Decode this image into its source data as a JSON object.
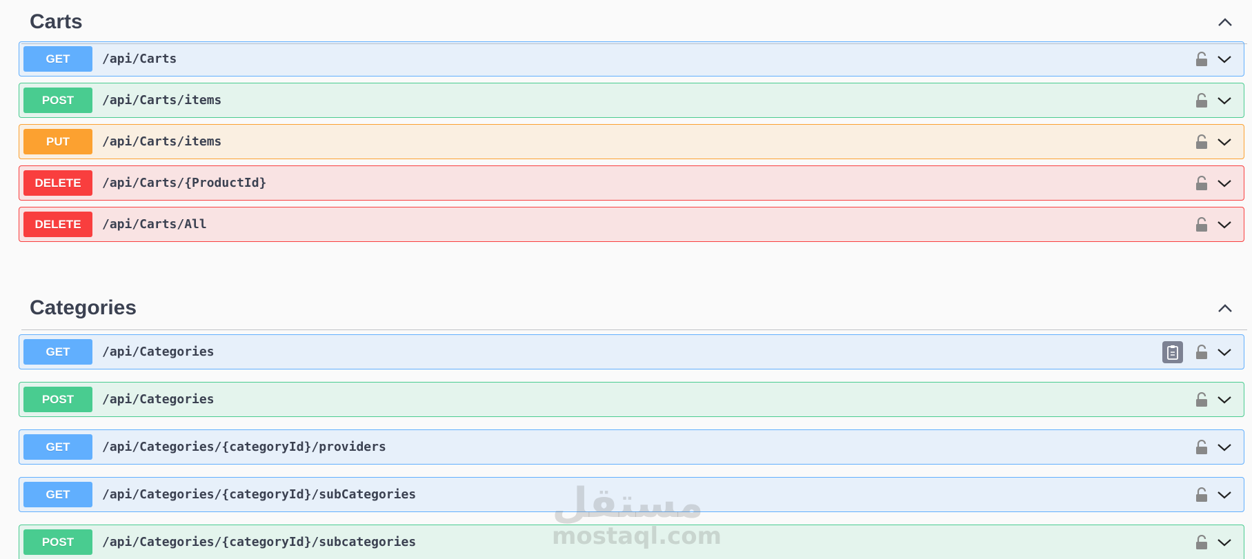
{
  "sections": [
    {
      "title": "Carts",
      "operations": [
        {
          "method": "GET",
          "path": "/api/Carts"
        },
        {
          "method": "POST",
          "path": "/api/Carts/items"
        },
        {
          "method": "PUT",
          "path": "/api/Carts/items"
        },
        {
          "method": "DELETE",
          "path": "/api/Carts/{ProductId}"
        },
        {
          "method": "DELETE",
          "path": "/api/Carts/All"
        }
      ]
    },
    {
      "title": "Categories",
      "operations": [
        {
          "method": "GET",
          "path": "/api/Categories"
        },
        {
          "method": "POST",
          "path": "/api/Categories"
        },
        {
          "method": "GET",
          "path": "/api/Categories/{categoryId}/providers"
        },
        {
          "method": "GET",
          "path": "/api/Categories/{categoryId}/subCategories"
        },
        {
          "method": "POST",
          "path": "/api/Categories/{categoryId}/subcategories"
        }
      ]
    }
  ],
  "icons": {
    "lock": "lock-icon",
    "expand": "chevron-down-icon",
    "collapse": "chevron-up-icon",
    "copy": "clipboard-copy-icon"
  },
  "colors": {
    "get": "#61affe",
    "post": "#49cc90",
    "put": "#fca130",
    "delete": "#f93e3e"
  },
  "watermark": {
    "arabic": "مستقل",
    "latin": "mostaql.com"
  }
}
